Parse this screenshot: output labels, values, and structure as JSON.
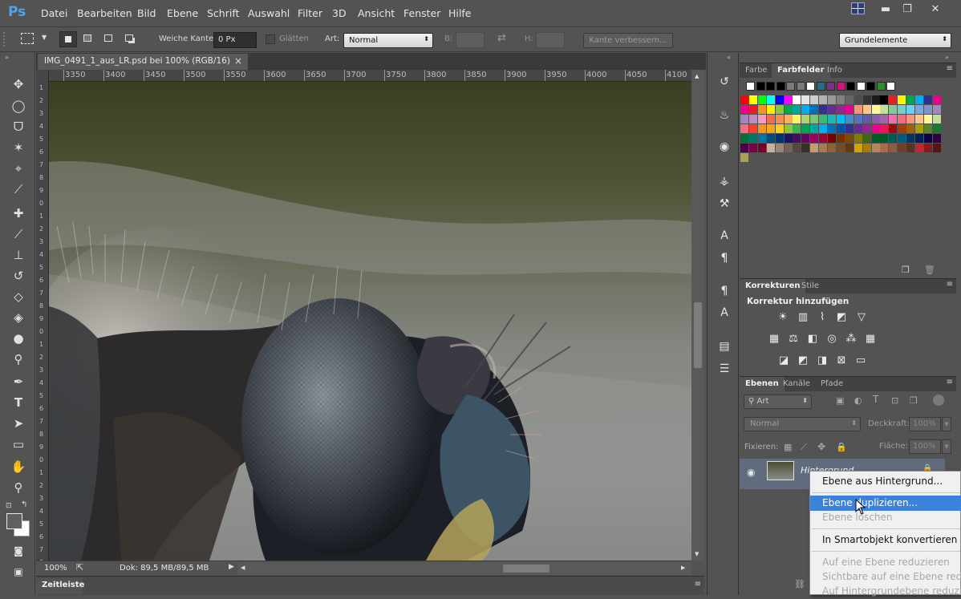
{
  "app": {
    "logo": "Ps"
  },
  "menu": [
    "Datei",
    "Bearbeiten",
    "Bild",
    "Ebene",
    "Schrift",
    "Auswahl",
    "Filter",
    "3D",
    "Ansicht",
    "Fenster",
    "Hilfe"
  ],
  "window_controls": {
    "minimize": "▬",
    "restore": "❐",
    "close": "✕"
  },
  "options_bar": {
    "soft_edge_label": "Weiche Kante:",
    "soft_edge_value": "0 Px",
    "smooth_label": "Glätten",
    "style_label": "Art:",
    "style_value": "Normal",
    "width_label": "B:",
    "height_label": "H:",
    "refine_edge_button": "Kante verbessern...",
    "workspace_value": "Grundelemente"
  },
  "document": {
    "tab_title": "IMG_0491_1_aus_LR.psd bei 100% (RGB/16)",
    "close_glyph": "×",
    "ruler_top": [
      "3350",
      "3400",
      "3450",
      "3500",
      "3550",
      "3600",
      "3650",
      "3700",
      "3750",
      "3800",
      "3850",
      "3900",
      "3950",
      "4000",
      "4050",
      "4100"
    ],
    "ruler_left": [
      "1",
      "2",
      "3",
      "4",
      "5",
      "6",
      "7",
      "8",
      "9",
      "0",
      "1",
      "2",
      "3",
      "4",
      "5",
      "6",
      "7",
      "8",
      "9",
      "0",
      "1",
      "2",
      "3",
      "4",
      "5",
      "6",
      "7",
      "8",
      "9",
      "0",
      "1",
      "2",
      "3",
      "4",
      "5",
      "6",
      "7",
      "8"
    ]
  },
  "status": {
    "zoom": "100%",
    "doc_size": "Dok: 89,5 MB/89,5 MB"
  },
  "timeline": {
    "label": "Zeitleiste"
  },
  "panels": {
    "swatches": {
      "tabs": [
        "Farbe",
        "Farbfelder",
        "Info"
      ],
      "active_tab": "Farbfelder",
      "top_row": [
        "#ffffff",
        "#000000",
        "#000000",
        "#000000",
        "#7a7a7a",
        "#7a7a7a",
        "#ffffff",
        "#1f6f8b",
        "#7b2e8e",
        "#d4107a",
        "#000000",
        "#ffffff",
        "#000000",
        "#2f8f2f",
        "#ffffff"
      ],
      "grid": [
        [
          "#ff0000",
          "#ffff00",
          "#00ff00",
          "#00ffff",
          "#0000ff",
          "#ff00ff",
          "#ffffff",
          "#e6e6e6",
          "#cccccc",
          "#b3b3b3",
          "#999999",
          "#808080",
          "#666666",
          "#4d4d4d",
          "#333333",
          "#1a1a1a",
          "#000000",
          "#ed1c24",
          "#fff200",
          "#00a651",
          "#00aeef",
          "#2e3192",
          "#ec008c"
        ],
        [
          "#ec008c",
          "#ed1c24",
          "#f7941d",
          "#fff200",
          "#8dc63f",
          "#00a651",
          "#00a99d",
          "#00aeef",
          "#0072bc",
          "#2e3192",
          "#662d91",
          "#92278f",
          "#ec008c",
          "#f69679",
          "#fdc689",
          "#fff799",
          "#c4df9b",
          "#82ca9c",
          "#7accc8",
          "#6dcff6",
          "#7da7d9",
          "#8393ca",
          "#a187be"
        ],
        [
          "#a187be",
          "#bc8dbf",
          "#f49ac1",
          "#f26c4f",
          "#f68e55",
          "#fbaf5c",
          "#fff467",
          "#acd372",
          "#7cc576",
          "#3bb878",
          "#1abbb4",
          "#00bff3",
          "#438ccb",
          "#5574b9",
          "#605ca8",
          "#855fa8",
          "#a763a8",
          "#f06eaa",
          "#f26d7d",
          "#f7977a",
          "#fdc68c",
          "#fff79a",
          "#c4df9b"
        ],
        [
          "#f26d7d",
          "#f7412d",
          "#f7941d",
          "#f8a51b",
          "#fcd116",
          "#8dc63f",
          "#39b54a",
          "#00a651",
          "#00a99d",
          "#00aeef",
          "#0072bc",
          "#0054a6",
          "#2e3192",
          "#662d91",
          "#92278f",
          "#ec008c",
          "#ed145b",
          "#9e0b0f",
          "#a0410d",
          "#a36209",
          "#aba000",
          "#598527",
          "#197b30"
        ],
        [
          "#007236",
          "#00746b",
          "#0076a3",
          "#004b80",
          "#003471",
          "#1b1464",
          "#440e62",
          "#630460",
          "#9e005d",
          "#9e0039",
          "#790000",
          "#7b2e00",
          "#7d4900",
          "#827b00",
          "#406618",
          "#005e20",
          "#005826",
          "#005952",
          "#005b7f",
          "#003663",
          "#002157",
          "#0d004c",
          "#32004b"
        ],
        [
          "#4b0049",
          "#7b0046",
          "#7a0026",
          "#c7b299",
          "#998675",
          "#736357",
          "#534741",
          "#37302a",
          "#c69c6d",
          "#a67c52",
          "#8c6239",
          "#754c24",
          "#603913",
          "#cfa500",
          "#a87d00",
          "#b8865d",
          "#a86b4b",
          "#8f5a3e",
          "#6e3f2a",
          "#593223",
          "#c2272d",
          "#8b1a1a",
          "#5c1313"
        ],
        [
          "#aaa055"
        ]
      ]
    },
    "adjustments": {
      "tabs": [
        "Korrekturen",
        "Stile"
      ],
      "active_tab": "Korrekturen",
      "heading": "Korrektur hinzufügen"
    },
    "layers": {
      "tabs": [
        "Ebenen",
        "Kanäle",
        "Pfade"
      ],
      "active_tab": "Ebenen",
      "filter_value": "Art",
      "blend_mode": "Normal",
      "opacity_label": "Deckkraft:",
      "opacity_value": "100%",
      "lock_label": "Fixieren:",
      "fill_label": "Fläche:",
      "fill_value": "100%",
      "layer_name": "Hintergrund"
    }
  },
  "context_menu": {
    "items": [
      {
        "label": "Ebene aus Hintergrund...",
        "state": "enabled"
      },
      {
        "label": "Ebene duplizieren...",
        "state": "highlighted"
      },
      {
        "label": "Ebene löschen",
        "state": "disabled"
      },
      {
        "label": "In Smartobjekt konvertieren",
        "state": "enabled"
      },
      {
        "label": "Auf eine Ebene reduzieren",
        "state": "disabled"
      },
      {
        "label": "Sichtbare auf eine Ebene reduzieren",
        "state": "disabled"
      },
      {
        "label": "Auf Hintergrundebene reduzieren",
        "state": "disabled"
      }
    ]
  }
}
